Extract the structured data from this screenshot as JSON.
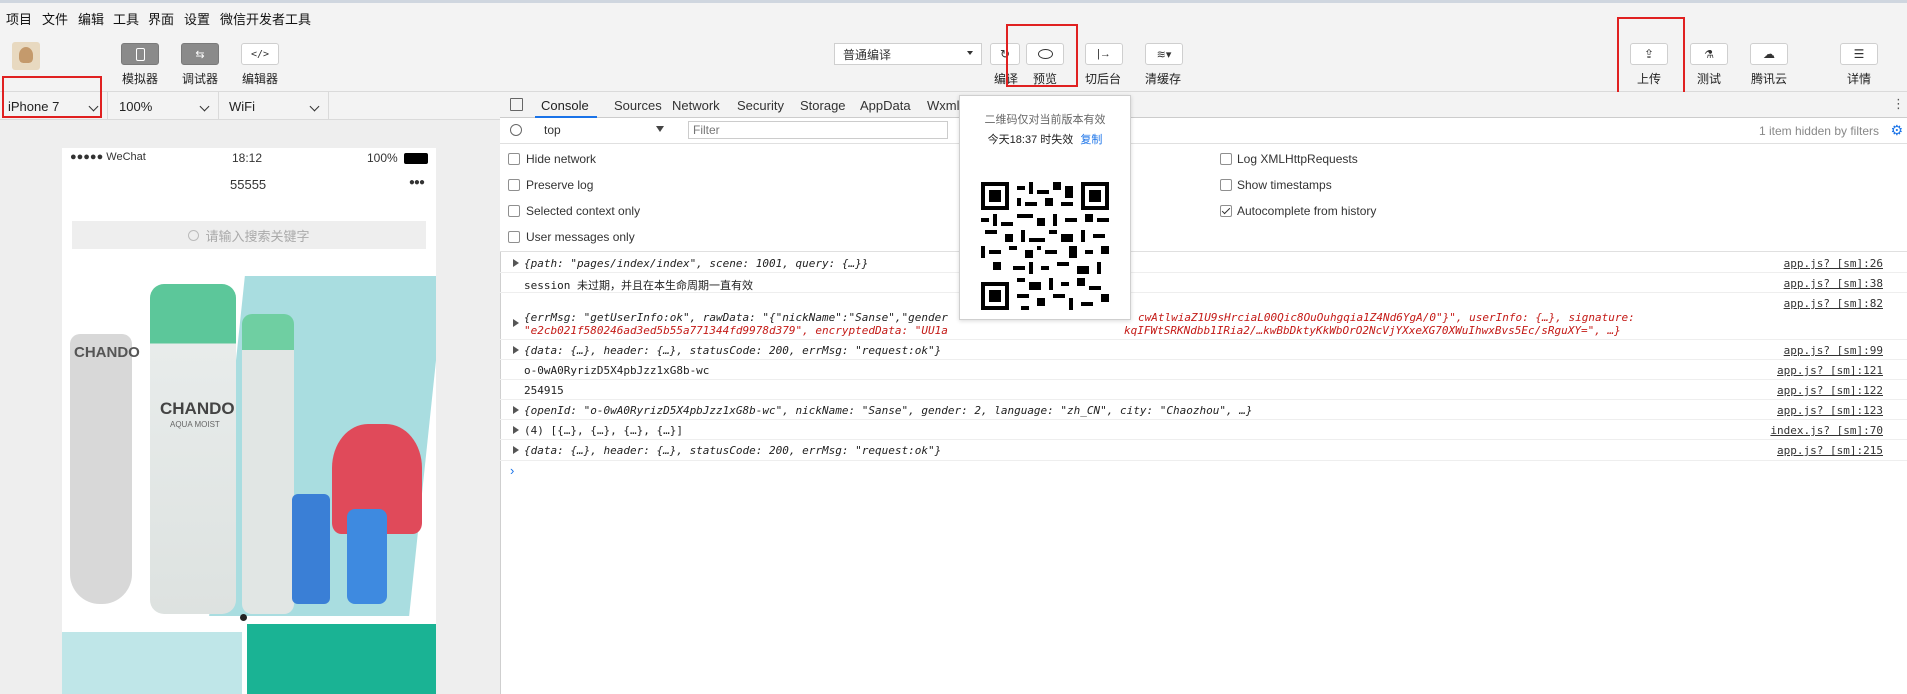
{
  "menu": [
    "项目",
    "文件",
    "编辑",
    "工具",
    "界面",
    "设置",
    "微信开发者工具"
  ],
  "toolbar": {
    "simulator": "模拟器",
    "debugger": "调试器",
    "editor": "编辑器",
    "compile_mode": "普通编译",
    "compile": "编译",
    "preview": "预览",
    "background": "切后台",
    "clear_cache": "清缓存",
    "upload": "上传",
    "test": "测试",
    "tencent_cloud": "腾讯云",
    "details": "详情"
  },
  "simbar": {
    "device": "iPhone 7",
    "zoom": "100%",
    "network": "WiFi"
  },
  "phone": {
    "carrier": "●●●●● WeChat",
    "time": "18:12",
    "battery": "100%",
    "title": "55555",
    "search_placeholder": "请输入搜索关键字",
    "brand": "CHANDO",
    "brand_sub": "AQUA MOIST"
  },
  "devtools": {
    "tabs": [
      "Console",
      "Sources",
      "Network",
      "Security",
      "Storage",
      "AppData",
      "Wxml"
    ],
    "context": "top",
    "filter_placeholder": "Filter",
    "hidden_note": "1 item hidden by filters",
    "options_left": [
      "Hide network",
      "Preserve log",
      "Selected context only",
      "User messages only"
    ],
    "options_right": [
      "Log XMLHttpRequests",
      "Show timestamps",
      "Autocomplete from history"
    ],
    "options_right_checked": [
      false,
      false,
      true
    ]
  },
  "logs": [
    {
      "text": "{path: \"pages/index/index\", scene: 1001, query: {…}}",
      "src": "app.js? [sm]:26",
      "expand": true
    },
    {
      "text": "session 未过期，并且在本生命周期一直有效",
      "src": "app.js? [sm]:38",
      "expand": false
    },
    {
      "text": "{errMsg: \"getUserInfo:ok\", rawData: \"{\"nickName\":\"Sanse\",\"gender",
      "text_b": "cwAtlwiaZ1U9sHrciaL00Qic8OuOuhgqia1Z4Nd6YgA/0\"}\", userInfo: {…}, signature:",
      "text2": "\"e2cb021f580246ad3ed5b55a771344fd9978d379\", encryptedData: \"UU1a",
      "text2_b": "kqIFWtSRKNdbb1IRia2/…kwBbDktyKkWbOrO2NcVjYXxeXG70XWuIhwxBvs5Ec/sRguXY=\", …}",
      "src": "app.js? [sm]:82",
      "expand": true
    },
    {
      "text": "{data: {…}, header: {…}, statusCode: 200, errMsg: \"request:ok\"}",
      "src": "app.js? [sm]:99",
      "expand": true
    },
    {
      "text": "o-0wA0RyrizD5X4pbJzz1xG8b-wc",
      "src": "app.js? [sm]:121",
      "expand": false
    },
    {
      "text": "254915",
      "src": "app.js? [sm]:122",
      "expand": false
    },
    {
      "text": "{openId: \"o-0wA0RyrizD5X4pbJzz1xG8b-wc\", nickName: \"Sanse\", gender: 2, language: \"zh_CN\", city: \"Chaozhou\", …}",
      "src": "app.js? [sm]:123",
      "expand": true
    },
    {
      "text": "(4) [{…}, {…}, {…}, {…}]",
      "src": "index.js? [sm]:70",
      "expand": true
    },
    {
      "text": "{data: {…}, header: {…}, statusCode: 200, errMsg: \"request:ok\"}",
      "src": "app.js? [sm]:215",
      "expand": true
    }
  ],
  "popup": {
    "note": "二维码仅对当前版本有效",
    "expiry": "今天18:37 时失效",
    "copy": "复制"
  }
}
